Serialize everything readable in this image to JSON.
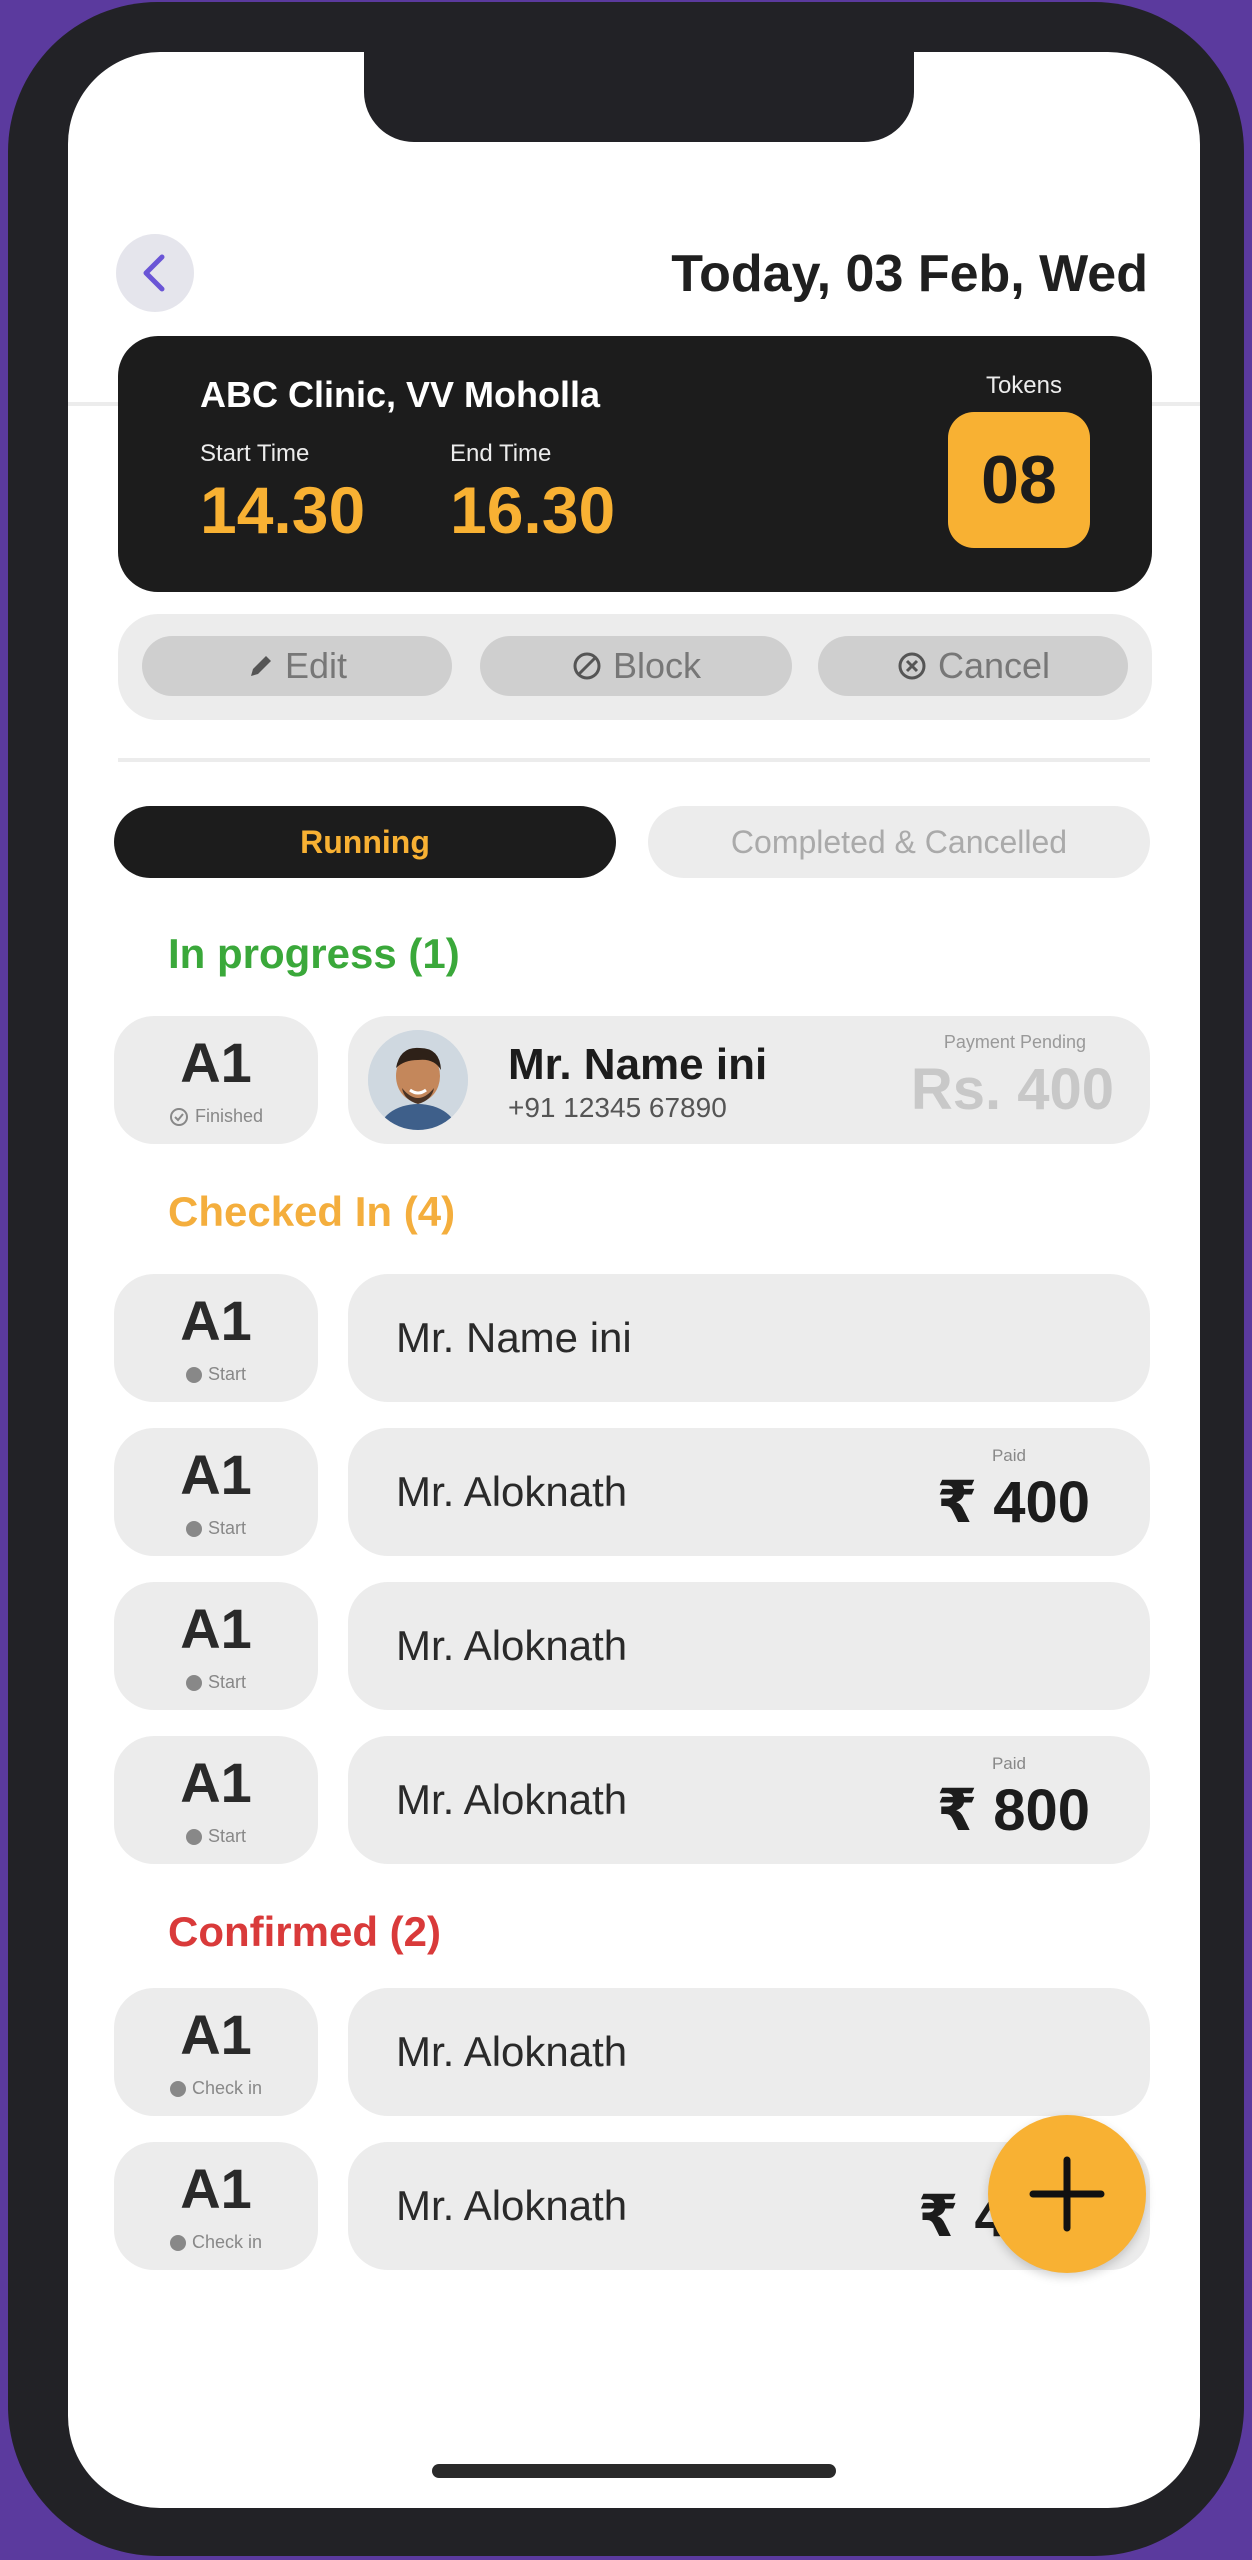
{
  "header": {
    "title": "Today, 03 Feb, Wed"
  },
  "clinic": {
    "name": "ABC Clinic, VV Moholla",
    "start_label": "Start Time",
    "start_value": "14.30",
    "end_label": "End Time",
    "end_value": "16.30",
    "tokens_label": "Tokens",
    "tokens_value": "08"
  },
  "actions": {
    "edit": "Edit",
    "block": "Block",
    "cancel": "Cancel"
  },
  "tabs": {
    "running": "Running",
    "completed": "Completed & Cancelled"
  },
  "in_progress": {
    "heading": "In progress (1)",
    "item": {
      "token": "A1",
      "status": "Finished",
      "name": "Mr. Name ini",
      "phone": "+91 12345 67890",
      "payment_label": "Payment Pending",
      "amount": "Rs. 400"
    }
  },
  "checked_in": {
    "heading": "Checked In (4)",
    "items": [
      {
        "token": "A1",
        "status": "Start",
        "name": "Mr. Name ini",
        "paid_label": "",
        "amount": ""
      },
      {
        "token": "A1",
        "status": "Start",
        "name": "Mr. Aloknath",
        "paid_label": "Paid",
        "amount": "₹ 400"
      },
      {
        "token": "A1",
        "status": "Start",
        "name": "Mr. Aloknath",
        "paid_label": "",
        "amount": ""
      },
      {
        "token": "A1",
        "status": "Start",
        "name": "Mr. Aloknath",
        "paid_label": "Paid",
        "amount": "₹ 800"
      }
    ]
  },
  "confirmed": {
    "heading": "Confirmed (2)",
    "items": [
      {
        "token": "A1",
        "status": "Check in",
        "name": "Mr. Aloknath",
        "paid_label": "",
        "amount": ""
      },
      {
        "token": "A1",
        "status": "Check in",
        "name": "Mr. Aloknath",
        "paid_label": "P",
        "amount": "₹ 4"
      }
    ]
  },
  "colors": {
    "accent": "#f8b133",
    "dark": "#1c1c1c",
    "in_progress": "#3aa83a",
    "checked_in": "#f4ae3d",
    "confirmed": "#d93a3a",
    "frame": "#5b3a9e"
  },
  "icons": {
    "back": "chevron-left-icon",
    "edit": "pencil-icon",
    "block": "block-icon",
    "cancel": "cancel-circle-icon",
    "finished": "check-circle-icon",
    "add": "plus-icon"
  }
}
